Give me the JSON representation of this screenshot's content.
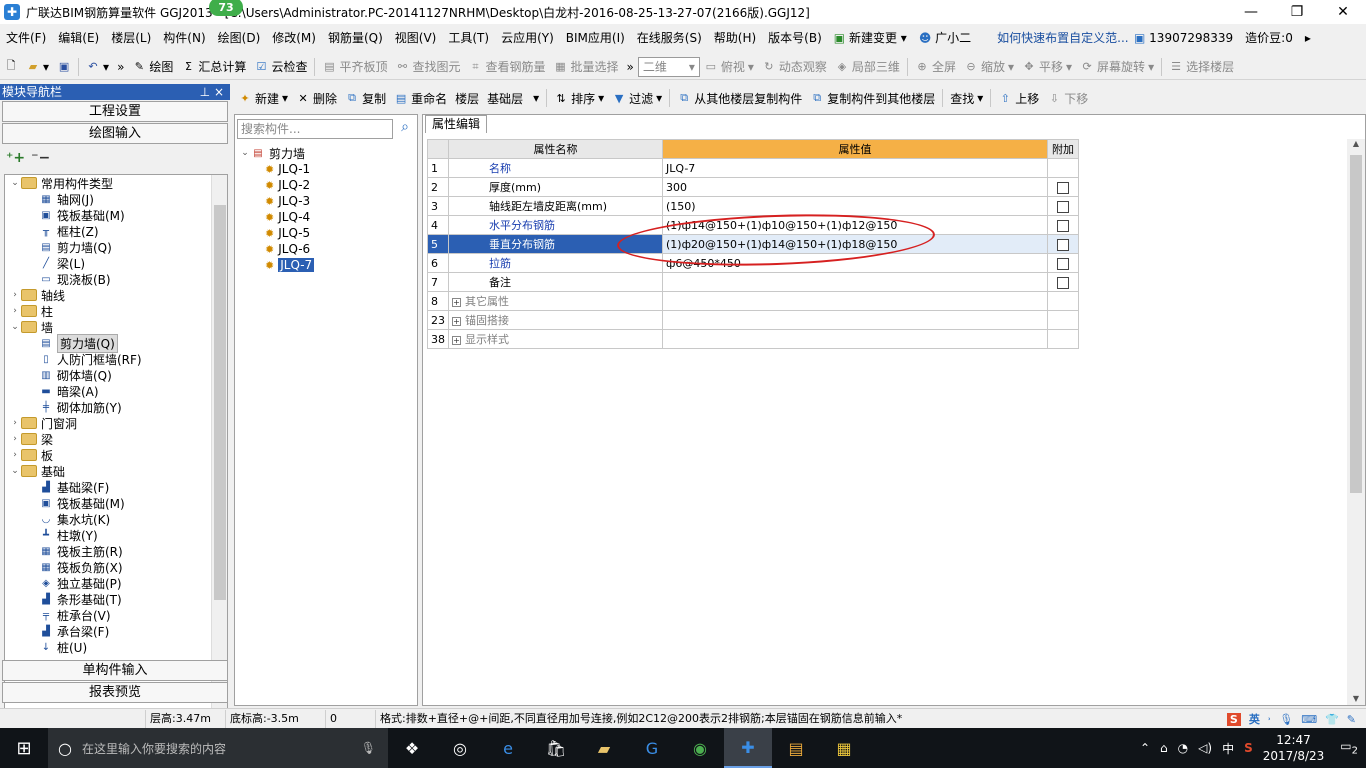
{
  "titlebar": {
    "title": "广联达BIM钢筋算量软件 GGJ2013 - [C:\\Users\\Administrator.PC-20141127NRHM\\Desktop\\白龙村-2016-08-25-13-27-07(2166版).GGJ12]",
    "badge": "73"
  },
  "menu": {
    "items": [
      "文件(F)",
      "编辑(E)",
      "楼层(L)",
      "构件(N)",
      "绘图(D)",
      "修改(M)",
      "钢筋量(Q)",
      "视图(V)",
      "工具(T)",
      "云应用(Y)",
      "BIM应用(I)",
      "在线服务(S)",
      "帮助(H)",
      "版本号(B)",
      "新建变更",
      "广小二"
    ],
    "hint": "如何快速布置自定义范...",
    "phone": "13907298339",
    "price": "造价豆:0"
  },
  "toolbar1": {
    "draw": "绘图",
    "sum": "汇总计算",
    "cloud_check": "云检查",
    "flat_top": "平齐板顶",
    "find_elem": "查找图元",
    "view_rebar": "查看钢筋量",
    "batch_select": "批量选择",
    "view_mode": "二维",
    "top_view": "俯视",
    "dynamic": "动态观察",
    "local3d": "局部三维",
    "fullscreen": "全屏",
    "zoom": "缩放",
    "pan": "平移",
    "rotate": "屏幕旋转",
    "select_floor": "选择楼层"
  },
  "nav": {
    "title": "模块导航栏",
    "pin": "⊥ ×",
    "project_settings": "工程设置",
    "drawing_input": "绘图输入",
    "single_input": "单构件输入",
    "report_preview": "报表预览",
    "tree": [
      {
        "level": 0,
        "exp": "⌄",
        "type": "folder",
        "label": "常用构件类型"
      },
      {
        "level": 1,
        "icon": "▦",
        "label": "轴网(J)"
      },
      {
        "level": 1,
        "icon": "▣",
        "label": "筏板基础(M)"
      },
      {
        "level": 1,
        "icon": "╥",
        "label": "框柱(Z)"
      },
      {
        "level": 1,
        "icon": "▤",
        "label": "剪力墙(Q)"
      },
      {
        "level": 1,
        "icon": "╱",
        "label": "梁(L)"
      },
      {
        "level": 1,
        "icon": "▭",
        "label": "现浇板(B)"
      },
      {
        "level": 0,
        "exp": "›",
        "type": "folder",
        "label": "轴线"
      },
      {
        "level": 0,
        "exp": "›",
        "type": "folder",
        "label": "柱"
      },
      {
        "level": 0,
        "exp": "⌄",
        "type": "folder",
        "label": "墙"
      },
      {
        "level": 1,
        "icon": "▤",
        "label": "剪力墙(Q)",
        "selected": true
      },
      {
        "level": 1,
        "icon": "▯",
        "label": "人防门框墙(RF)"
      },
      {
        "level": 1,
        "icon": "▥",
        "label": "砌体墙(Q)"
      },
      {
        "level": 1,
        "icon": "▬",
        "label": "暗梁(A)"
      },
      {
        "level": 1,
        "icon": "╪",
        "label": "砌体加筋(Y)"
      },
      {
        "level": 0,
        "exp": "›",
        "type": "folder",
        "label": "门窗洞"
      },
      {
        "level": 0,
        "exp": "›",
        "type": "folder",
        "label": "梁"
      },
      {
        "level": 0,
        "exp": "›",
        "type": "folder",
        "label": "板"
      },
      {
        "level": 0,
        "exp": "⌄",
        "type": "folder",
        "label": "基础"
      },
      {
        "level": 1,
        "icon": "▟",
        "label": "基础梁(F)"
      },
      {
        "level": 1,
        "icon": "▣",
        "label": "筏板基础(M)"
      },
      {
        "level": 1,
        "icon": "◡",
        "label": "集水坑(K)"
      },
      {
        "level": 1,
        "icon": "┻",
        "label": "柱墩(Y)"
      },
      {
        "level": 1,
        "icon": "▦",
        "label": "筏板主筋(R)"
      },
      {
        "level": 1,
        "icon": "▦",
        "label": "筏板负筋(X)"
      },
      {
        "level": 1,
        "icon": "◈",
        "label": "独立基础(P)"
      },
      {
        "level": 1,
        "icon": "▟",
        "label": "条形基础(T)"
      },
      {
        "level": 1,
        "icon": "╤",
        "label": "桩承台(V)"
      },
      {
        "level": 1,
        "icon": "▟",
        "label": "承台梁(F)"
      },
      {
        "level": 1,
        "icon": "↓",
        "label": "桩(U)"
      }
    ]
  },
  "comptools": {
    "new": "新建",
    "delete": "删除",
    "copy": "复制",
    "rename": "重命名",
    "floor_label": "楼层",
    "floor_value": "基础层",
    "sort": "排序",
    "filter": "过滤",
    "copy_from": "从其他楼层复制构件",
    "copy_to": "复制构件到其他楼层",
    "find": "查找",
    "move_up": "上移",
    "move_down": "下移"
  },
  "complist": {
    "search_placeholder": "搜索构件...",
    "root": "剪力墙",
    "items": [
      "JLQ-1",
      "JLQ-2",
      "JLQ-3",
      "JLQ-4",
      "JLQ-5",
      "JLQ-6",
      "JLQ-7"
    ],
    "selected": "JLQ-7"
  },
  "props": {
    "tab": "属性编辑",
    "headers": {
      "name": "属性名称",
      "value": "属性值",
      "add": "附加"
    },
    "rows": [
      {
        "num": "1",
        "name": "名称",
        "value": "JLQ-7",
        "style": "blue",
        "check": false
      },
      {
        "num": "2",
        "name": "厚度(mm)",
        "value": "300",
        "style": "",
        "check": true
      },
      {
        "num": "3",
        "name": "轴线距左墙皮距离(mm)",
        "value": "(150)",
        "style": "",
        "check": true
      },
      {
        "num": "4",
        "name": "水平分布钢筋",
        "value": "(1)ф14@150+(1)ф10@150+(1)ф12@150",
        "style": "blue",
        "check": true
      },
      {
        "num": "5",
        "name": "垂直分布钢筋",
        "value": "(1)ф20@150+(1)ф14@150+(1)ф18@150",
        "style": "blue",
        "check": true,
        "selected": true
      },
      {
        "num": "6",
        "name": "拉筋",
        "value": "ф6@450*450",
        "style": "blue",
        "check": true
      },
      {
        "num": "7",
        "name": "备注",
        "value": "",
        "style": "",
        "check": true
      },
      {
        "num": "8",
        "name": "其它属性",
        "value": "",
        "style": "gray",
        "plus": true
      },
      {
        "num": "23",
        "name": "锚固搭接",
        "value": "",
        "style": "gray",
        "plus": true
      },
      {
        "num": "38",
        "name": "显示样式",
        "value": "",
        "style": "gray",
        "plus": true
      }
    ]
  },
  "status": {
    "floor_height": "层高:3.47m",
    "bottom_height": "底标高:-3.5m",
    "zero": "0",
    "format_hint": "格式:排数+直径+@+间距,不同直径用加号连接,例如2C12@200表示2排钢筋;本层锚固在钢筋信息前输入*",
    "ime": "英"
  },
  "taskbar": {
    "search_placeholder": "在这里输入你要搜索的内容",
    "time": "12:47",
    "date": "2017/8/23",
    "lang": "中",
    "notif": "2"
  }
}
